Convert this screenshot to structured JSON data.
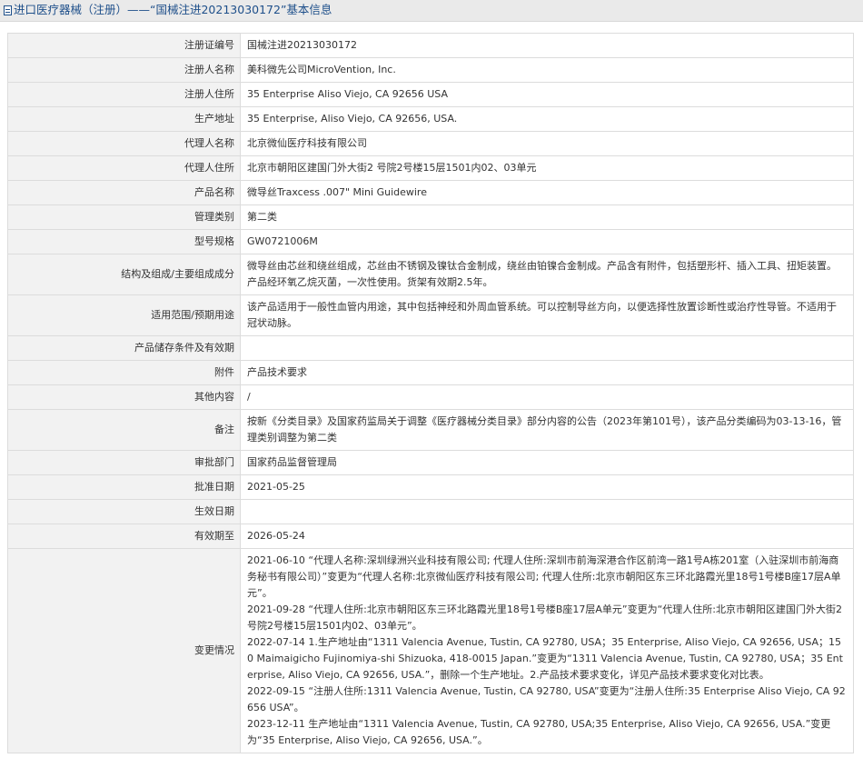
{
  "header": {
    "title": "进口医疗器械（注册）——“国械注进20213030172”基本信息"
  },
  "rows": [
    {
      "label": "注册证编号",
      "value": "国械注进20213030172"
    },
    {
      "label": "注册人名称",
      "value": "美科微先公司MicroVention, Inc."
    },
    {
      "label": "注册人住所",
      "value": "35 Enterprise Aliso Viejo, CA 92656 USA"
    },
    {
      "label": "生产地址",
      "value": "35 Enterprise, Aliso Viejo, CA 92656, USA."
    },
    {
      "label": "代理人名称",
      "value": "北京微仙医疗科技有限公司"
    },
    {
      "label": "代理人住所",
      "value": "北京市朝阳区建国门外大街2 号院2号楼15层1501内02、03单元"
    },
    {
      "label": "产品名称",
      "value": "微导丝Traxcess .007\" Mini Guidewire"
    },
    {
      "label": "管理类别",
      "value": "第二类"
    },
    {
      "label": "型号规格",
      "value": "GW0721006M"
    },
    {
      "label": "结构及组成/主要组成成分",
      "value": "微导丝由芯丝和绕丝组成，芯丝由不锈钢及镍钛合金制成，绕丝由铂镍合金制成。产品含有附件，包括塑形杆、插入工具、扭矩装置。产品经环氧乙烷灭菌，一次性使用。货架有效期2.5年。"
    },
    {
      "label": "适用范围/预期用途",
      "value": "该产品适用于一般性血管内用途，其中包括神经和外周血管系统。可以控制导丝方向，以便选择性放置诊断性或治疗性导管。不适用于冠状动脉。"
    },
    {
      "label": "产品储存条件及有效期",
      "value": ""
    },
    {
      "label": "附件",
      "value": "产品技术要求"
    },
    {
      "label": "其他内容",
      "value": "/"
    },
    {
      "label": "备注",
      "value": "按新《分类目录》及国家药监局关于调整《医疗器械分类目录》部分内容的公告（2023年第101号），该产品分类编码为03-13-16，管理类别调整为第二类"
    },
    {
      "label": "审批部门",
      "value": "国家药品监督管理局"
    },
    {
      "label": "批准日期",
      "value": "2021-05-25"
    },
    {
      "label": "生效日期",
      "value": ""
    },
    {
      "label": "有效期至",
      "value": "2026-05-24"
    }
  ],
  "changes": {
    "label": "变更情况",
    "items": [
      "2021-06-10 “代理人名称:深圳绿洲兴业科技有限公司; 代理人住所:深圳市前海深港合作区前湾一路1号A栋201室（入驻深圳市前海商务秘书有限公司）”变更为“代理人名称:北京微仙医疗科技有限公司; 代理人住所:北京市朝阳区东三环北路霞光里18号1号楼B座17层A单元”。",
      "2021-09-28 “代理人住所:北京市朝阳区东三环北路霞光里18号1号楼B座17层A单元”变更为“代理人住所:北京市朝阳区建国门外大街2 号院2号楼15层1501内02、03单元”。",
      "2022-07-14 1.生产地址由“1311 Valencia Avenue, Tustin, CA 92780, USA；35 Enterprise, Aliso Viejo, CA 92656, USA；150 Maimaigicho Fujinomiya-shi Shizuoka, 418-0015 Japan.”变更为“1311 Valencia Avenue, Tustin, CA 92780, USA；35 Enterprise, Aliso Viejo, CA 92656, USA.”，删除一个生产地址。2.产品技术要求变化，详见产品技术要求变化对比表。",
      "2022-09-15 “注册人住所:1311 Valencia Avenue, Tustin, CA 92780, USA”变更为“注册人住所:35 Enterprise Aliso Viejo, CA 92656 USA”。",
      "2023-12-11 生产地址由“1311 Valencia Avenue, Tustin, CA 92780, USA;35 Enterprise, Aliso Viejo, CA 92656, USA.”变更为“35 Enterprise, Aliso Viejo, CA 92656, USA.”。"
    ]
  }
}
